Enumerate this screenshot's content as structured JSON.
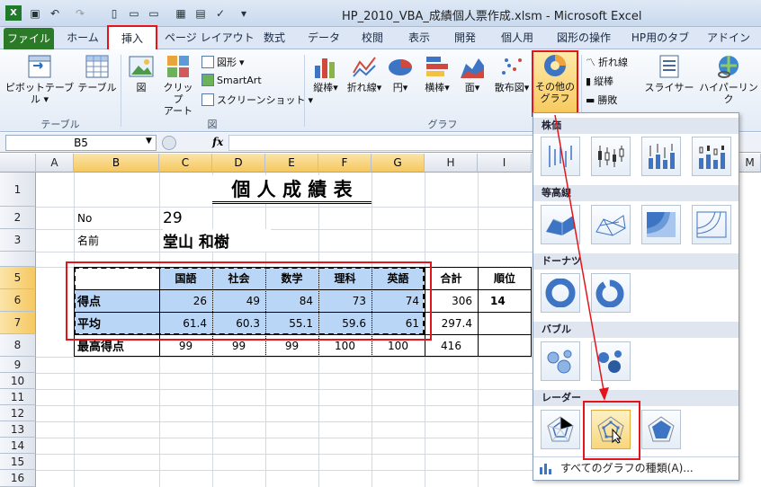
{
  "window": {
    "title": "HP_2010_VBA_成績個人票作成.xlsm - Microsoft Excel"
  },
  "tabs": [
    "ファイル",
    "ホーム",
    "挿入",
    "ページ レイアウト",
    "数式",
    "データ",
    "校閲",
    "表示",
    "開発",
    "個人用",
    "図形の操作",
    "HP用のタブ",
    "アドイン"
  ],
  "ribbon": {
    "pivot_table": "ピボットテーブル",
    "table": "テーブル",
    "picture": "図",
    "clipart_1": "クリップ",
    "clipart_2": "アート",
    "shapes": "図形",
    "smartart": "SmartArt",
    "screenshot": "スクリーンショット",
    "column": "縦棒",
    "line": "折れ線",
    "pie": "円",
    "bar": "横棒",
    "area": "面",
    "scatter": "散布図",
    "other_1": "その他の",
    "other_2": "グラフ",
    "spark_line": "折れ線",
    "spark_column": "縦棒",
    "spark_winloss": "勝敗",
    "slicer": "スライサー",
    "hyperlink": "ハイパーリンク",
    "group_table": "テーブル",
    "group_figure": "図",
    "group_chart": "グラフ"
  },
  "formula_bar": {
    "name_box": "B5",
    "fx": "fx"
  },
  "sheet": {
    "columns": [
      "A",
      "B",
      "C",
      "D",
      "E",
      "F",
      "G",
      "H",
      "I",
      "M"
    ],
    "rows": [
      "1",
      "2",
      "3",
      "5",
      "6",
      "7",
      "8",
      "9",
      "10",
      "11",
      "12",
      "13",
      "14",
      "15",
      "16"
    ],
    "title": "個 人 成 績 表",
    "no_label": "No",
    "no_value": "29",
    "name_label": "名前",
    "name_value": "堂山 和樹",
    "headers": [
      "国語",
      "社会",
      "数学",
      "理科",
      "英語",
      "合計",
      "順位"
    ],
    "score_label": "得点",
    "scores": [
      "26",
      "49",
      "84",
      "73",
      "74",
      "306",
      "14"
    ],
    "avg_label": "平均",
    "averages": [
      "61.4",
      "60.3",
      "55.1",
      "59.6",
      "61",
      "297.4"
    ],
    "max_label": "最高得点",
    "maxes": [
      "99",
      "99",
      "99",
      "100",
      "100",
      "416"
    ]
  },
  "gallery": {
    "stock": "株価",
    "surface": "等高線",
    "doughnut": "ドーナツ",
    "bubble": "バブル",
    "radar": "レーダー",
    "all_charts": "すべてのグラフの種類(A)..."
  },
  "colors": {
    "accent_red": "#e4141b",
    "file_tab": "#2a7a28",
    "selection": "#b9d6f6"
  }
}
